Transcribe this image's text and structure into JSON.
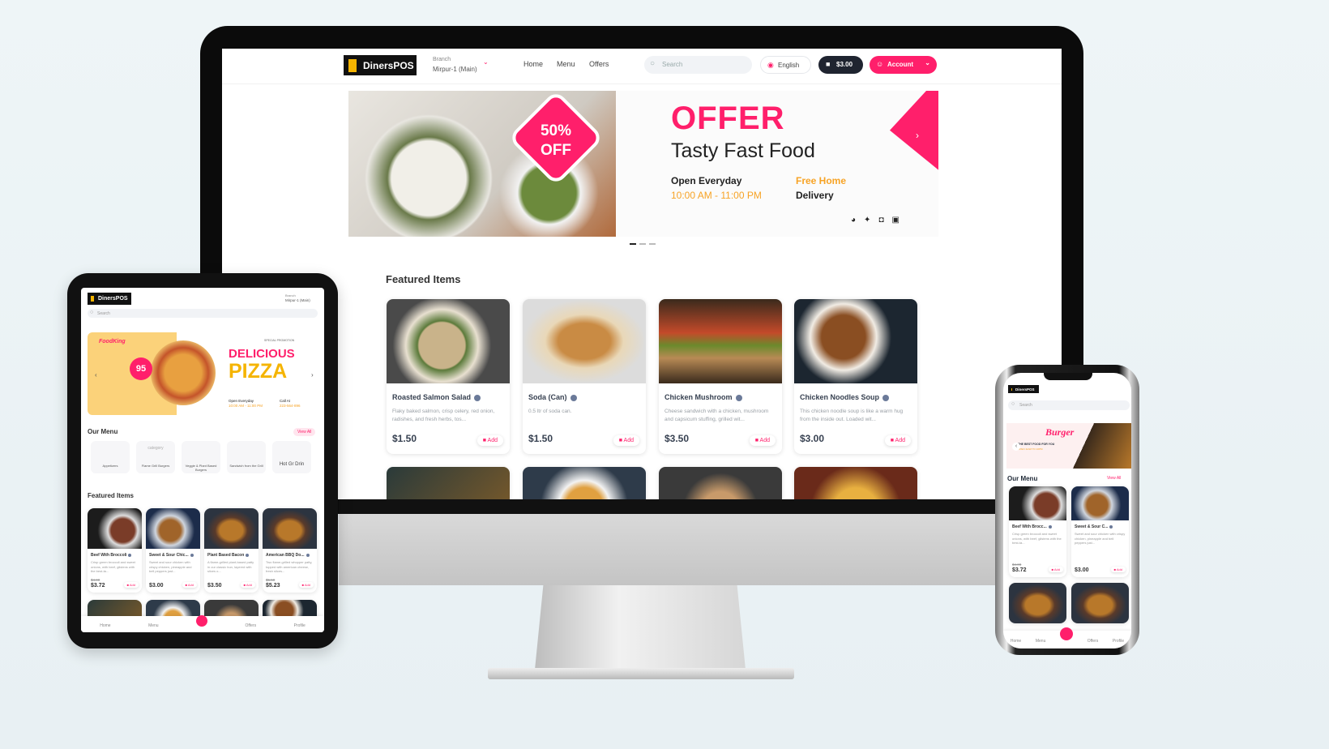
{
  "desktop": {
    "header": {
      "logo_text": "DinersPOS",
      "branch_label": "Branch",
      "branch_value": "Mirpur-1 (Main)",
      "nav": [
        "Home",
        "Menu",
        "Offers"
      ],
      "search_placeholder": "Search",
      "language": "English",
      "cart_total": "$3.00",
      "account_label": "Account"
    },
    "banner": {
      "badge_line1": "50%",
      "badge_line2": "OFF",
      "title": "OFFER",
      "subtitle": "Tasty Fast Food",
      "hours_label": "Open Everyday",
      "hours_value": "10:00 AM - 11:00 PM",
      "delivery_line1": "Free Home",
      "delivery_line2": "Delivery",
      "social_icons": [
        "whatsapp-icon",
        "twitter-icon",
        "instagram-icon",
        "facebook-icon"
      ],
      "active_slide": 1,
      "slide_count": 3
    },
    "featured_title": "Featured Items",
    "items": [
      {
        "name": "Roasted Salmon Salad",
        "desc": "Flaky baked salmon, crisp celery, red onion, radishes, and fresh herbs, tos...",
        "price": "$1.50",
        "add": "Add"
      },
      {
        "name": "Soda (Can)",
        "desc": "0.5 ltr of soda can.",
        "price": "$1.50",
        "add": "Add"
      },
      {
        "name": "Chicken Mushroom",
        "desc": "Cheese sandwich with a chicken, mushroom and capsicum stuffing, grilled wit...",
        "price": "$3.50",
        "add": "Add"
      },
      {
        "name": "Chicken Noodles Soup",
        "desc": "This chicken noodle soup is like a warm hug from the inside out. Loaded wit...",
        "price": "$3.00",
        "add": "Add"
      }
    ]
  },
  "tablet": {
    "logo_text": "DinersPOS",
    "branch_label": "Branch",
    "branch_value": "Mirpur-1 (Main)",
    "search_placeholder": "Search",
    "banner": {
      "brand": "FoodKing",
      "badge": "95",
      "promo": "SPECIAL PROMOTION",
      "title1": "DELICIOUS",
      "title2": "PIZZA",
      "hours_label": "Open Everyday",
      "hours_value": "10:00 AM - 11:00 PM",
      "call_label": "Call At",
      "call_value": "223-564-896"
    },
    "our_menu": "Our Menu",
    "view_all": "View All",
    "categories": [
      "Appetizers",
      "Flame Grill Burgers",
      "Veggie & Plant Based Burgers",
      "Sandwich from the Grill",
      "Hot Gr Drin"
    ],
    "category_alt": "category",
    "featured_title": "Featured Items",
    "items": [
      {
        "name": "Beef With Broccoli",
        "desc": "Crisp green broccoli and sweet onions, with beef, glistens with the best-ta...",
        "old_price": "$4.00",
        "price": "$3.72",
        "add": "Add"
      },
      {
        "name": "Sweet & Sour Chic...",
        "desc": "Sweet and sour chicken with crispy chicken, pineapple and bell peppers just...",
        "price": "$3.00",
        "add": "Add"
      },
      {
        "name": "Plant Based Bacon",
        "desc": "A flame-grilled plant-based patty in our classic bun, layered with slices o...",
        "price": "$3.50",
        "add": "Add"
      },
      {
        "name": "American BBQ Do...",
        "desc": "Two flame-grilled whopper patty, topped with american cheese, fresh slices...",
        "old_price": "$5.50",
        "price": "$5.23",
        "add": "Add"
      }
    ],
    "bottom_nav": [
      "Home",
      "Menu",
      "",
      "Offers",
      "Profile"
    ]
  },
  "phone": {
    "logo_text": "DinersPOS",
    "search_placeholder": "Search",
    "banner": {
      "title": "Burger",
      "line1": "THE BEST FOOD FOR YOU",
      "line2": "OPEN 11AM TO 10PM"
    },
    "our_menu": "Our Menu",
    "view_all": "View All",
    "items": [
      {
        "name": "Beef With Brocc...",
        "desc": "Crisp green broccoli and sweet onions, with beef, glistens with the best-ta...",
        "old_price": "$4.00",
        "price": "$3.72",
        "add": "Add"
      },
      {
        "name": "Sweet & Sour C...",
        "desc": "Sweet and sour chicken with crispy chicken, pineapple and bell peppers just...",
        "price": "$3.00",
        "add": "Add"
      }
    ],
    "bottom_nav": [
      "Home",
      "Menu",
      "",
      "Offers",
      "Profile"
    ]
  },
  "colors": {
    "accent": "#ff1f6b",
    "dark": "#1f2430",
    "yellow": "#f5b400",
    "orange": "#f7a325"
  }
}
